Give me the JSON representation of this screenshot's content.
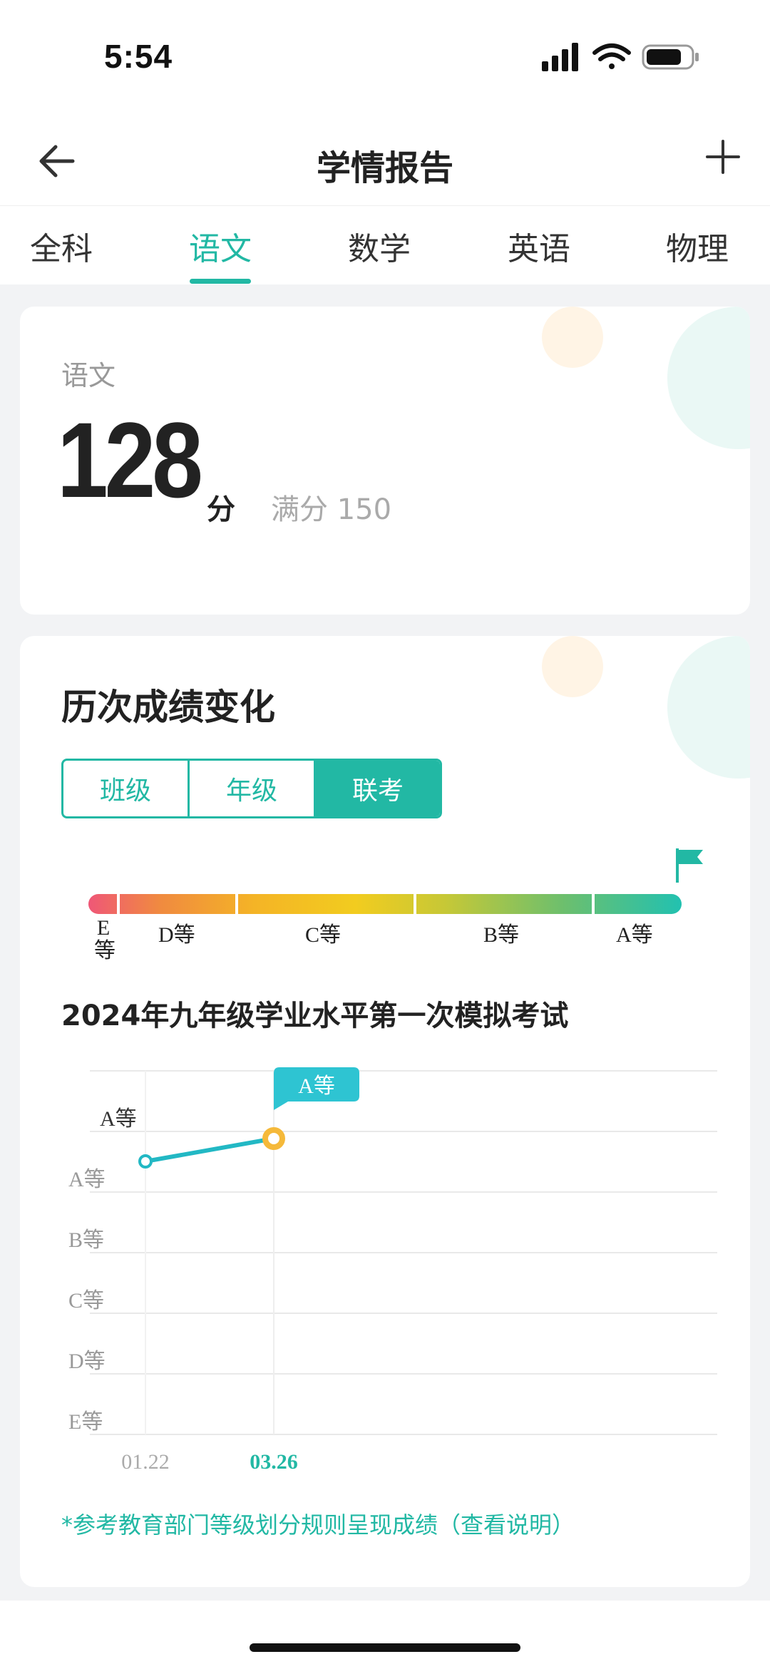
{
  "status_bar": {
    "time": "5:54"
  },
  "nav": {
    "title": "学情报告"
  },
  "tabs": [
    {
      "label": "全科",
      "active": false
    },
    {
      "label": "语文",
      "active": true
    },
    {
      "label": "数学",
      "active": false
    },
    {
      "label": "英语",
      "active": false
    },
    {
      "label": "物理",
      "active": false
    }
  ],
  "score_card": {
    "subject": "语文",
    "score": "128",
    "unit": "分",
    "full_score": "满分 150"
  },
  "trend_card": {
    "title": "历次成绩变化",
    "segments": [
      "班级",
      "年级",
      "联考"
    ],
    "active_segment": "联考",
    "grade_scale": [
      "E等",
      "D等",
      "C等",
      "B等",
      "A等"
    ],
    "exam_title": "2024年九年级学业水平第一次模拟考试",
    "note": "*参考教育部门等级划分规则呈现成绩（查看说明）"
  },
  "chart_data": {
    "type": "line",
    "y_categories": [
      "E等",
      "D等",
      "C等",
      "B等",
      "A等",
      "A等"
    ],
    "x": [
      "01.22",
      "03.26"
    ],
    "series": [
      {
        "values": [
          "A等",
          "A等"
        ]
      }
    ],
    "highlight": {
      "x": "03.26",
      "label": "A等"
    },
    "colors": {
      "line": "#22b8c4",
      "highlight_point": "#f5b93a",
      "tooltip": "#2ec4d2"
    }
  },
  "colors": {
    "accent": "#22b8a4"
  }
}
